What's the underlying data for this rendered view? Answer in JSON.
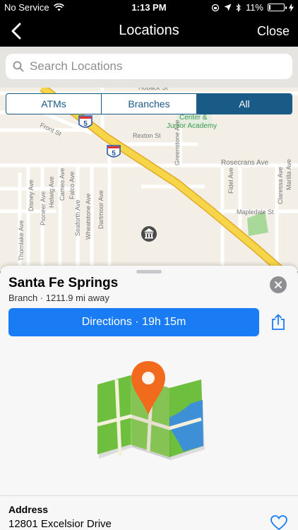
{
  "status_bar": {
    "carrier": "No Service",
    "time": "1:13 PM",
    "battery_percent": "11%",
    "battery_level": 0.11,
    "icons": [
      "wifi-icon",
      "location-arrow-icon",
      "bluetooth-icon",
      "orientation-lock-icon",
      "charging-icon"
    ]
  },
  "nav": {
    "back_icon": "chevron-left-icon",
    "title": "Locations",
    "close_label": "Close"
  },
  "search": {
    "placeholder": "Search Locations",
    "icon": "search-icon"
  },
  "filter": {
    "options": [
      "ATMs",
      "Branches",
      "All"
    ],
    "selected": "All"
  },
  "map": {
    "street_labels": [
      "Hoback St",
      "Front St",
      "Rexton St",
      "Rosecrans Ave",
      "Mapledale St",
      "Greenstone Ave",
      "Fidel Ave",
      "Claressa Ave",
      "Marilla Ave",
      "Disney Ave",
      "Helwig Ave",
      "Cameo Ave",
      "Falco Ave",
      "Seaforth Ave",
      "Wheatstone Ave",
      "Dartmoor Ave",
      "Pioneer Ave",
      "Thornlake Ave",
      "Center &",
      "Junior Academy"
    ],
    "highway_shield": "5",
    "marker_icon": "bank-icon"
  },
  "location": {
    "name": "Santa Fe Springs",
    "subtitle": "Branch · 1211.9 mi away",
    "directions_label": "Directions · 19h 15m",
    "share_icon": "share-icon",
    "close_icon": "close-icon",
    "address_label": "Address",
    "address_line": "12801 Excelsior Drive",
    "favorite_icon": "heart-icon"
  },
  "colors": {
    "accent": "#1a5a86",
    "button": "#1a7cf5",
    "freeway": "#f7d548"
  }
}
